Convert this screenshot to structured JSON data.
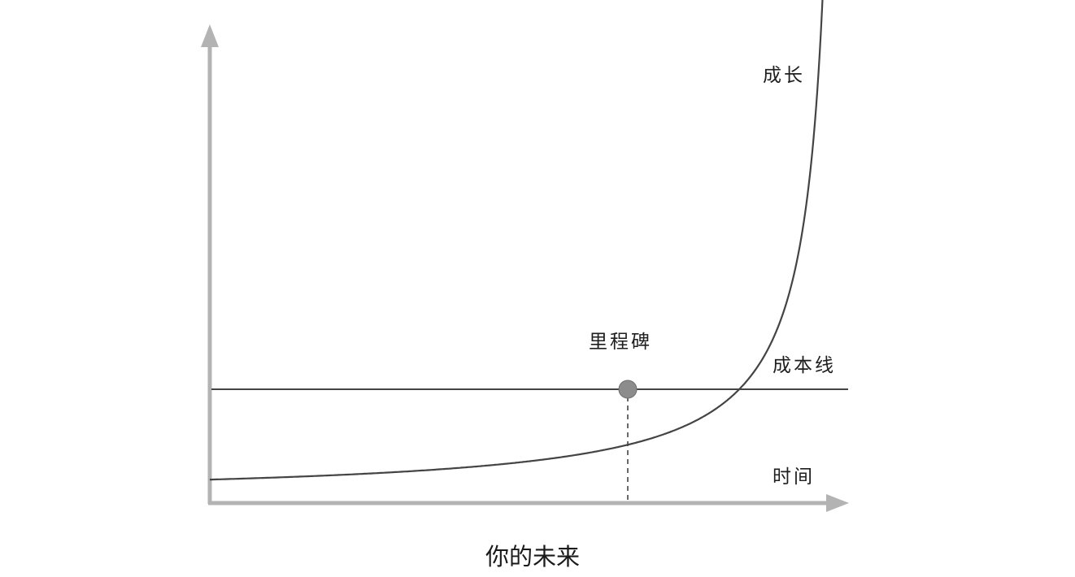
{
  "labels": {
    "growth": "成长",
    "cost_line": "成本线",
    "milestone": "里程碑",
    "time": "时间"
  },
  "caption": "你的未来",
  "colors": {
    "axis": "#b3b3b3",
    "line": "#444444",
    "marker": "#8c8c8c"
  }
}
